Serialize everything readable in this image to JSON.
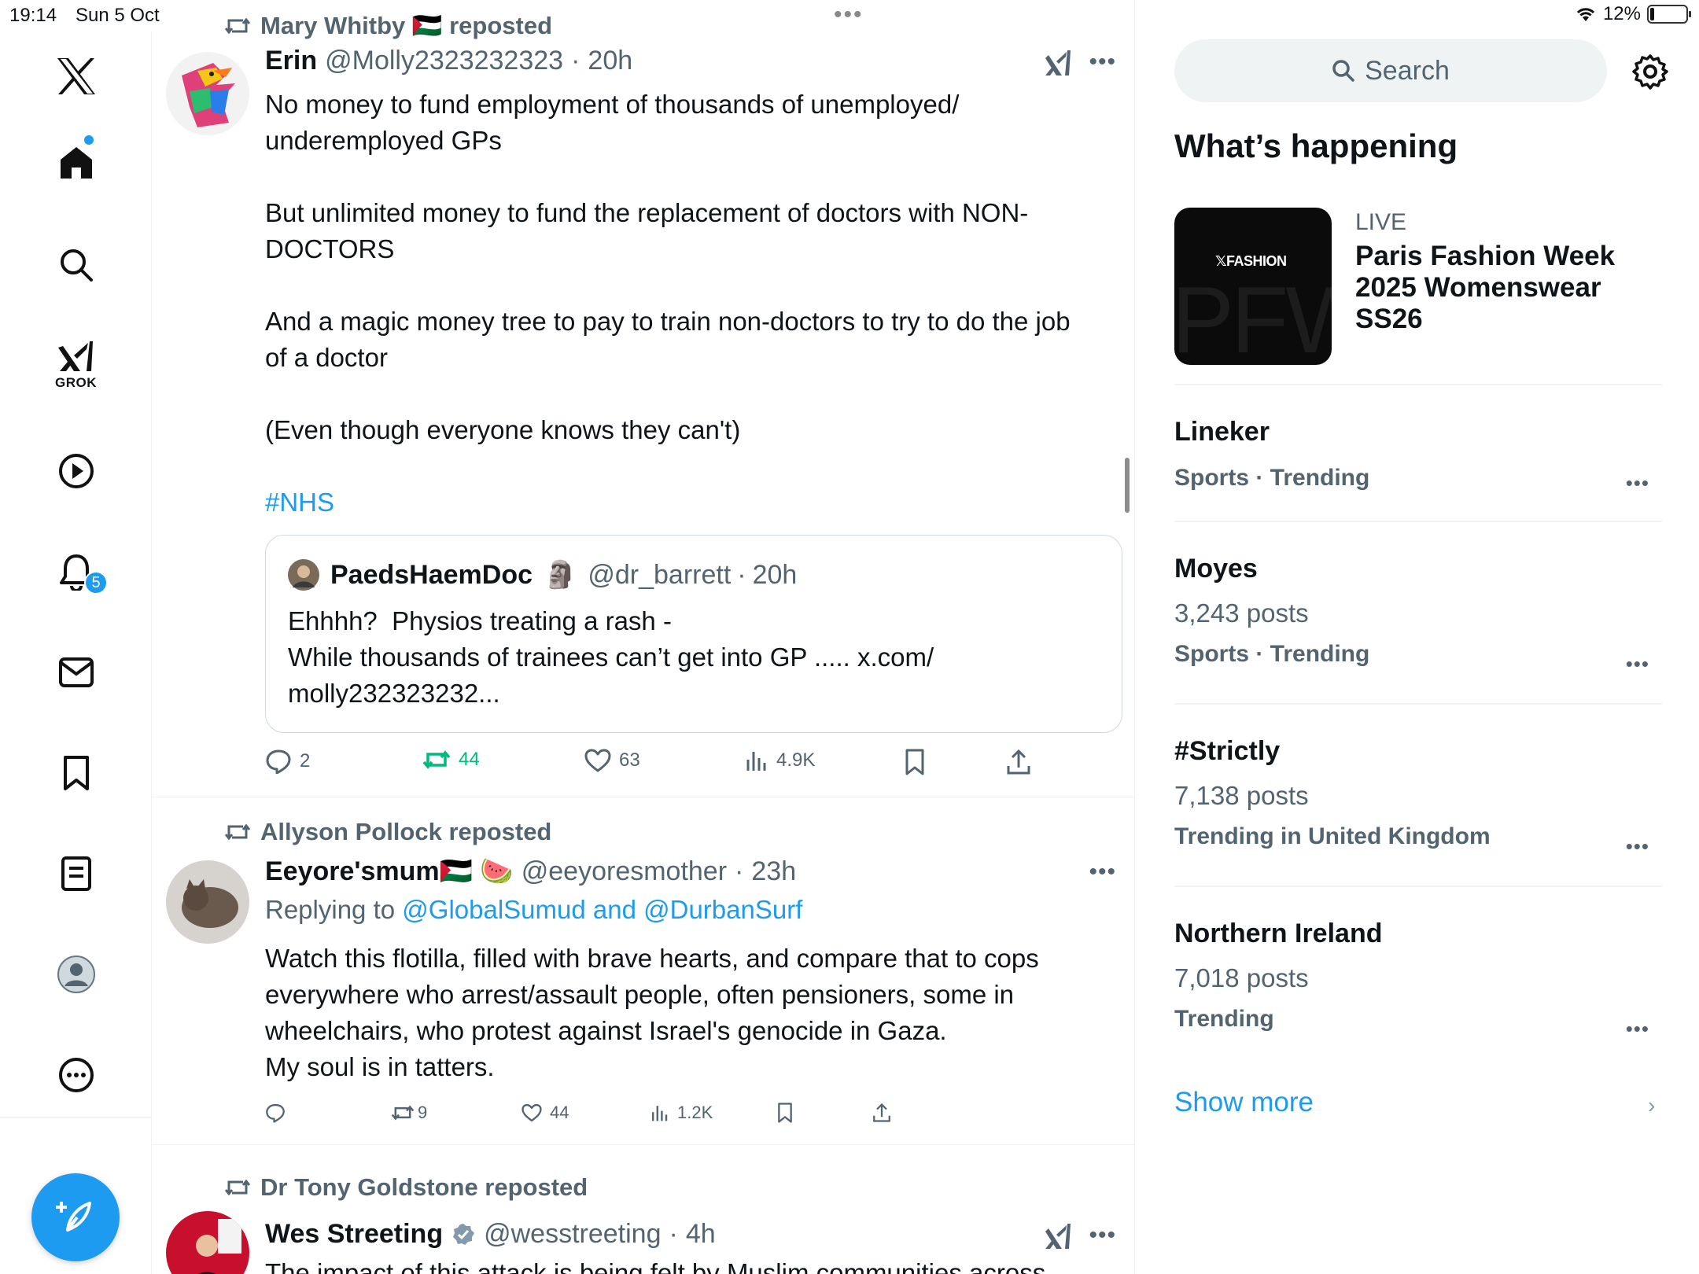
{
  "status_bar": {
    "time": "19:14",
    "date": "Sun 5 Oct",
    "battery": "12%",
    "battery_level_percent": 12
  },
  "nav": {
    "grok_label": "GROK",
    "notifications_badge": "5",
    "icons": [
      "x-logo-icon",
      "home-icon",
      "search-icon",
      "grok-icon",
      "video-icon",
      "bell-icon",
      "mail-icon",
      "bookmark-icon",
      "lists-icon",
      "profile-icon",
      "more-icon",
      "compose-icon"
    ]
  },
  "posts": [
    {
      "reposted_by": "Mary Whitby 🇵🇸 reposted",
      "name": "Erin",
      "handle": "@Molly2323232323",
      "sep": "·",
      "time": "20h",
      "paragraphs": [
        "No money to fund employment of thousands of unemployed/\nunderemployed GPs",
        "But unlimited money to fund the replacement of doctors with NON-\nDOCTORS",
        "And a magic money tree to pay to train non-doctors to try to do the job\nof a doctor",
        "(Even though everyone knows they can't)"
      ],
      "hashtag": "#NHS",
      "quote": {
        "name": "PaedsHaemDoc",
        "emoji": "🗿",
        "handle": "@dr_barrett",
        "sep": "·",
        "time": "20h",
        "text": "Ehhhh?  Physios treating a rash -\nWhile thousands of trainees can’t get into GP ..... x.com/\nmolly232323232..."
      },
      "stats": {
        "replies": "2",
        "reposts": "44",
        "likes": "63",
        "views": "4.9K"
      }
    },
    {
      "reposted_by": "Allyson Pollock reposted",
      "name": "Eeyore'smum🇵🇸 🍉",
      "handle": "@eeyoresmother",
      "sep": "·",
      "time": "23h",
      "replying_prefix": "Replying to",
      "replying_mentions": "@GlobalSumud and @DurbanSurf",
      "text": "Watch this flotilla, filled with brave hearts, and compare that to cops\neverywhere who arrest/assault people, often pensioners, some in\nwheelchairs, who protest against Israel's genocide in Gaza.\nMy soul is in tatters.",
      "stats": {
        "replies": "",
        "reposts": "9",
        "likes": "44",
        "views": "1.2K"
      }
    },
    {
      "reposted_by": "Dr Tony Goldstone reposted",
      "name": "Wes Streeting",
      "handle": "@wesstreeting",
      "sep": "·",
      "time": "4h",
      "text": "The impact of this attack is being felt by Muslim communities across"
    }
  ],
  "sidebar": {
    "search_placeholder": "Search",
    "title": "What’s happening",
    "live": {
      "label": "LIVE",
      "card_logo": "𝕏FASHION",
      "card_bg_text": "PFW",
      "title": "Paris Fashion Week 2025 Womenswear SS26"
    },
    "trends": [
      {
        "name": "Lineker",
        "posts": "",
        "category": "Sports · Trending"
      },
      {
        "name": "Moyes",
        "posts": "3,243 posts",
        "category": "Sports · Trending"
      },
      {
        "name": "#Strictly",
        "posts": "7,138 posts",
        "category": "Trending in United Kingdom"
      },
      {
        "name": "Northern Ireland",
        "posts": "7,018 posts",
        "category": "Trending"
      }
    ],
    "show_more": "Show more"
  },
  "colors": {
    "accent": "#1d9bf0",
    "repost_green": "#00ba7c",
    "secondary_text": "#536471",
    "primary_text": "#0f1419"
  }
}
